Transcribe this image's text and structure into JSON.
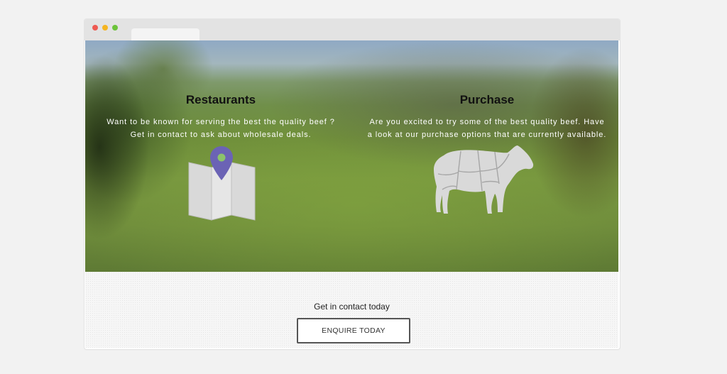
{
  "colors": {
    "page_background": "#f2f2f2",
    "title_bar": "#e3e3e3",
    "traffic_lights": [
      "#ee5a52",
      "#f5b521",
      "#6cc33a"
    ],
    "pin": "#6b63b5",
    "pin_center": "#8cc36b",
    "icon_fill": "#d9d9d9",
    "button_border": "#555555"
  },
  "hero": {
    "restaurants": {
      "title": "Restaurants",
      "line1": "Want to be known for serving the best the quality beef ?",
      "line2": "Get in contact to ask about wholesale deals.",
      "icon": "map-pin-icon"
    },
    "purchase": {
      "title": "Purchase",
      "line1": "Are you excited to try some of the best quality beef. Have",
      "line2": "a look at our purchase options that are currently available.",
      "icon": "cow-icon"
    }
  },
  "footer": {
    "cta_text": "Get in contact today",
    "button_label": "ENQUIRE TODAY"
  }
}
